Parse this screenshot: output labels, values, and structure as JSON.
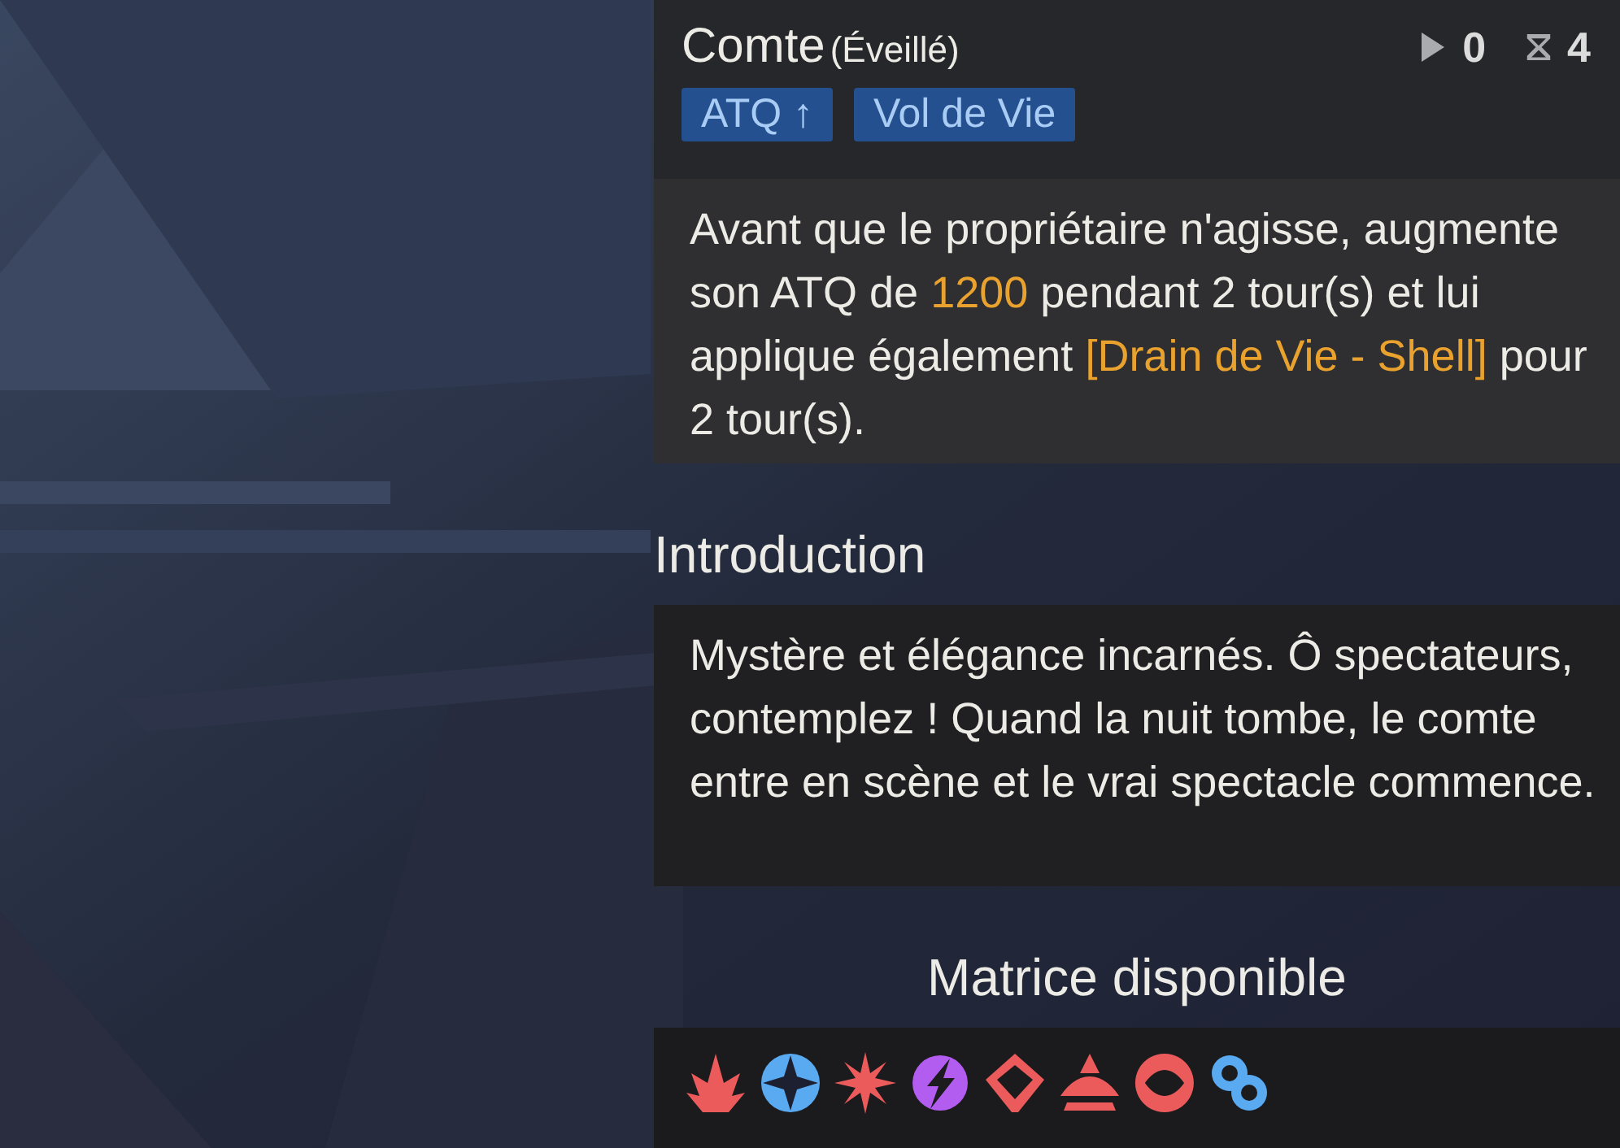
{
  "skill": {
    "name": "Comte",
    "form": "(Éveillé)",
    "counters": [
      {
        "kind": "play",
        "value": "0"
      },
      {
        "kind": "hourglass",
        "value": "4"
      }
    ],
    "tags": [
      "ATQ ↑",
      "Vol de Vie"
    ],
    "description": [
      {
        "text": "Avant que le propriétaire n'agisse, augmente son ATQ de ",
        "highlight": false
      },
      {
        "text": "1200",
        "highlight": true
      },
      {
        "text": " pendant 2 tour(s) et lui applique également ",
        "highlight": false
      },
      {
        "text": "[Drain de Vie - Shell]",
        "highlight": true
      },
      {
        "text": " pour 2 tour(s).",
        "highlight": false
      }
    ]
  },
  "introduction": {
    "title": "Introduction",
    "text": "Mystère et élégance incarnés. Ô spectateurs, contemplez ! Quand la nuit tombe, le comte entre en scène et le vrai spectacle commence."
  },
  "matrix": {
    "title": "Matrice disponible",
    "icons": [
      {
        "kind": "flame",
        "color": "#ec5b5b"
      },
      {
        "kind": "star",
        "color": "#5aaaf2"
      },
      {
        "kind": "spark",
        "color": "#ec5b5b"
      },
      {
        "kind": "bolt",
        "color": "#b25cf0"
      },
      {
        "kind": "diamond",
        "color": "#ec5b5b"
      },
      {
        "kind": "pyramid",
        "color": "#ec5b5b"
      },
      {
        "kind": "eye",
        "color": "#ec5b5b"
      },
      {
        "kind": "rings",
        "color": "#5aaaf2"
      }
    ]
  }
}
